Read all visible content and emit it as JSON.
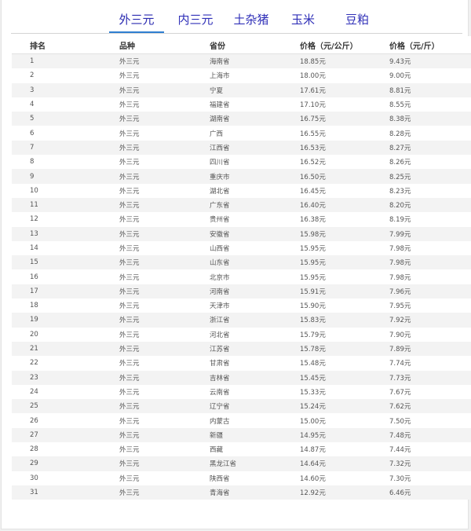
{
  "tabs": [
    {
      "label": "外三元",
      "active": true
    },
    {
      "label": "内三元",
      "active": false
    },
    {
      "label": "土杂猪",
      "active": false
    },
    {
      "label": "玉米",
      "active": false
    },
    {
      "label": "豆粕",
      "active": false
    }
  ],
  "table": {
    "headers": [
      "排名",
      "品种",
      "省份",
      "价格（元/公斤）",
      "价格（元/斤）"
    ],
    "rows": [
      [
        "1",
        "外三元",
        "海南省",
        "18.85元",
        "9.43元"
      ],
      [
        "2",
        "外三元",
        "上海市",
        "18.00元",
        "9.00元"
      ],
      [
        "3",
        "外三元",
        "宁夏",
        "17.61元",
        "8.81元"
      ],
      [
        "4",
        "外三元",
        "福建省",
        "17.10元",
        "8.55元"
      ],
      [
        "5",
        "外三元",
        "湖南省",
        "16.75元",
        "8.38元"
      ],
      [
        "6",
        "外三元",
        "广西",
        "16.55元",
        "8.28元"
      ],
      [
        "7",
        "外三元",
        "江西省",
        "16.53元",
        "8.27元"
      ],
      [
        "8",
        "外三元",
        "四川省",
        "16.52元",
        "8.26元"
      ],
      [
        "9",
        "外三元",
        "重庆市",
        "16.50元",
        "8.25元"
      ],
      [
        "10",
        "外三元",
        "湖北省",
        "16.45元",
        "8.23元"
      ],
      [
        "11",
        "外三元",
        "广东省",
        "16.40元",
        "8.20元"
      ],
      [
        "12",
        "外三元",
        "贵州省",
        "16.38元",
        "8.19元"
      ],
      [
        "13",
        "外三元",
        "安徽省",
        "15.98元",
        "7.99元"
      ],
      [
        "14",
        "外三元",
        "山西省",
        "15.95元",
        "7.98元"
      ],
      [
        "15",
        "外三元",
        "山东省",
        "15.95元",
        "7.98元"
      ],
      [
        "16",
        "外三元",
        "北京市",
        "15.95元",
        "7.98元"
      ],
      [
        "17",
        "外三元",
        "河南省",
        "15.91元",
        "7.96元"
      ],
      [
        "18",
        "外三元",
        "天津市",
        "15.90元",
        "7.95元"
      ],
      [
        "19",
        "外三元",
        "浙江省",
        "15.83元",
        "7.92元"
      ],
      [
        "20",
        "外三元",
        "河北省",
        "15.79元",
        "7.90元"
      ],
      [
        "21",
        "外三元",
        "江苏省",
        "15.78元",
        "7.89元"
      ],
      [
        "22",
        "外三元",
        "甘肃省",
        "15.48元",
        "7.74元"
      ],
      [
        "23",
        "外三元",
        "吉林省",
        "15.45元",
        "7.73元"
      ],
      [
        "24",
        "外三元",
        "云南省",
        "15.33元",
        "7.67元"
      ],
      [
        "25",
        "外三元",
        "辽宁省",
        "15.24元",
        "7.62元"
      ],
      [
        "26",
        "外三元",
        "内蒙古",
        "15.00元",
        "7.50元"
      ],
      [
        "27",
        "外三元",
        "新疆",
        "14.95元",
        "7.48元"
      ],
      [
        "28",
        "外三元",
        "西藏",
        "14.87元",
        "7.44元"
      ],
      [
        "29",
        "外三元",
        "黑龙江省",
        "14.64元",
        "7.32元"
      ],
      [
        "30",
        "外三元",
        "陕西省",
        "14.60元",
        "7.30元"
      ],
      [
        "31",
        "外三元",
        "青海省",
        "12.92元",
        "6.46元"
      ]
    ]
  },
  "colors": {
    "tab_text": "#3030b8",
    "tab_active_underline": "#2f7fd1",
    "row_stripe": "#f3f3f3"
  }
}
